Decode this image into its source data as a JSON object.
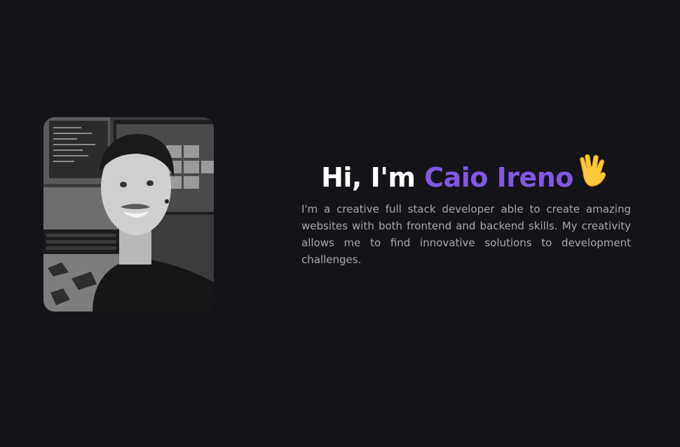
{
  "hero": {
    "greeting": "Hi, I'm ",
    "name": "Caio Ireno",
    "wave_icon": "vulcan-salute-icon",
    "bio": "I'm a creative full stack developer able to create amazing websites with both frontend and backend skills. My creativity allows me to find innovative solutions to development challenges.",
    "photo": "profile-photo"
  },
  "colors": {
    "background": "#141318",
    "accent": "#8257e5",
    "heading": "#ffffff",
    "text": "#a8a8b3"
  }
}
